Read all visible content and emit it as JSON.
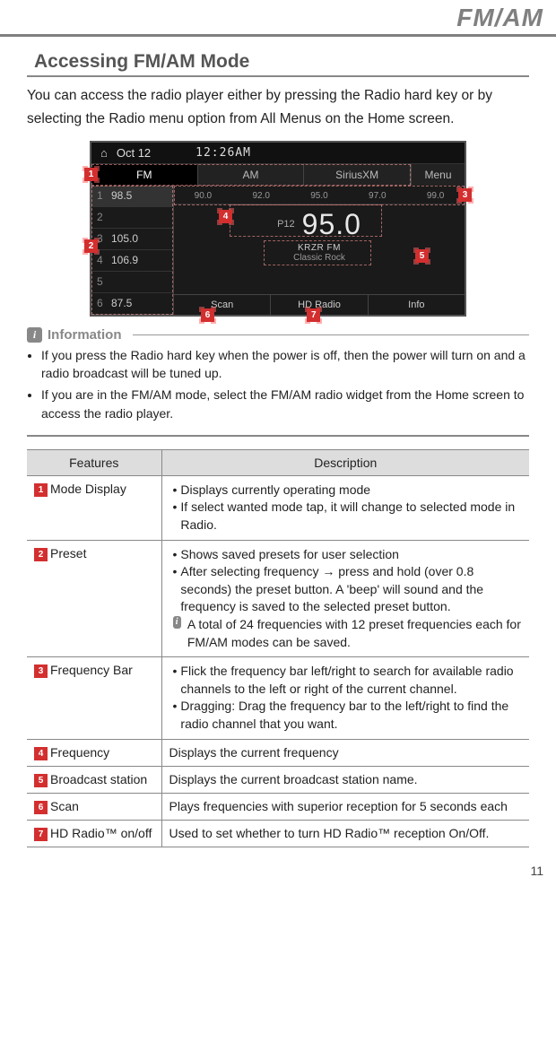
{
  "header": {
    "title": "FM/AM"
  },
  "section": {
    "heading": "Accessing FM/AM Mode"
  },
  "intro": "You can access the radio player either by pressing the Radio hard key or by selecting the Radio menu option from All Menus on the Home screen.",
  "screenshot": {
    "date": "Oct 12",
    "time": "12:26AM",
    "modes": [
      "FM",
      "AM",
      "SiriusXM"
    ],
    "selected_mode_index": 0,
    "menu_label": "Menu",
    "presets": [
      {
        "slot": "1",
        "freq": "98.5"
      },
      {
        "slot": "2",
        "freq": ""
      },
      {
        "slot": "3",
        "freq": "105.0"
      },
      {
        "slot": "4",
        "freq": "106.9"
      },
      {
        "slot": "5",
        "freq": ""
      },
      {
        "slot": "6",
        "freq": "87.5"
      }
    ],
    "freq_ticks": [
      "90.0",
      "92.0",
      "95.0",
      "97.0",
      "99.0"
    ],
    "preset_num": "P12",
    "big_freq": "95.0",
    "station": "KRZR FM",
    "genre": "Classic Rock",
    "bottom": [
      "Scan",
      "HD Radio",
      "Info"
    ]
  },
  "info": {
    "label": "Information",
    "items": [
      "If you press the Radio hard key when the power is off, then the power will turn on and a radio broadcast will be tuned up.",
      "If you are in the FM/AM mode, select the FM/AM radio widget from the Home screen to access the radio player."
    ]
  },
  "table": {
    "headers": {
      "features": "Features",
      "description": "Description"
    },
    "rows": [
      {
        "num": "1",
        "feature": "Mode Display",
        "desc_items": [
          "Displays currently operating mode",
          "If select wanted mode tap, it will change to selected mode in Radio."
        ]
      },
      {
        "num": "2",
        "feature": "Preset",
        "desc_items": [
          "Shows saved presets for user selection",
          "After selecting frequency → press and hold (over 0.8 seconds) the preset button.  A 'beep' will sound and the frequency is saved to the selected preset button."
        ],
        "desc_info": "A total of 24 frequencies with 12 preset frequencies each for FM/AM modes can be saved."
      },
      {
        "num": "3",
        "feature": "Frequency Bar",
        "desc_items": [
          "Flick the frequency bar left/right to search for available radio channels to the left or right of the current channel.",
          "Dragging: Drag the frequency bar to the left/right to find the radio channel that you want."
        ]
      },
      {
        "num": "4",
        "feature": "Frequency",
        "desc_plain": "Displays the current frequency"
      },
      {
        "num": "5",
        "feature": "Broadcast station",
        "desc_plain": "Displays the current broadcast station name."
      },
      {
        "num": "6",
        "feature": "Scan",
        "desc_plain": "Plays frequencies with superior reception for 5 seconds each"
      },
      {
        "num": "7",
        "feature": "HD Radio™ on/off",
        "desc_plain": "Used to set whether to turn HD Radio™ reception On/Off."
      }
    ]
  },
  "pagenum": "11"
}
